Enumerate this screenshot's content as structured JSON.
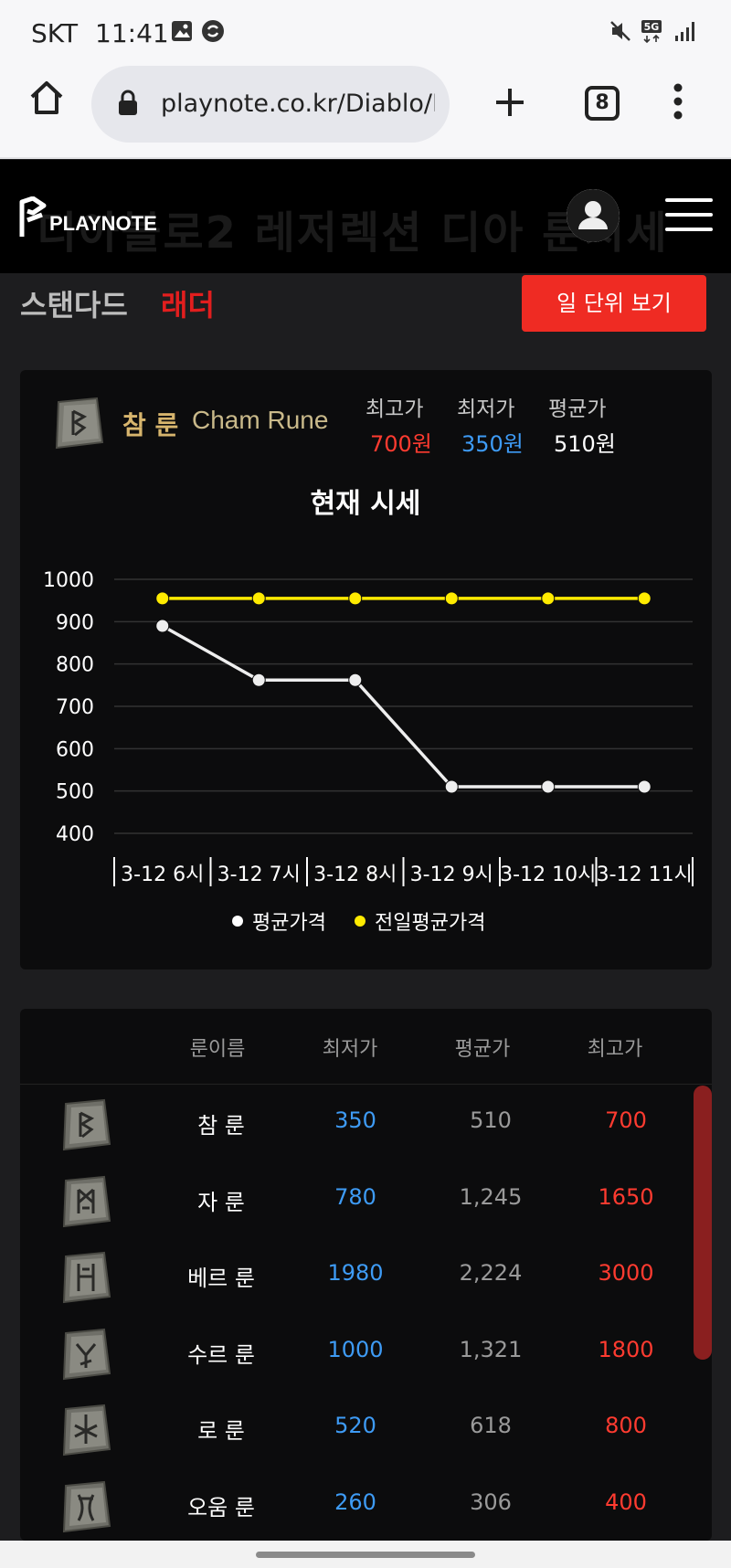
{
  "status_bar": {
    "carrier": "SKT",
    "time": "11:41",
    "network": "5G"
  },
  "browser": {
    "url": "playnote.co.kr/Diablo/Ru",
    "tab_count": "8"
  },
  "site": {
    "logo_text": "PLAYNOTE",
    "ghost_title": "디아블로2 레저렉션 디아 룬시세"
  },
  "mode": {
    "standard": "스탠다드",
    "ladder": "래더",
    "daily_button": "일 단위 보기"
  },
  "rune_card": {
    "name_kr": "참 룬",
    "name_en": "Cham Rune",
    "stats": [
      {
        "label": "최고가",
        "value": "700원",
        "color": "#ff3b30"
      },
      {
        "label": "최저가",
        "value": "350원",
        "color": "#3e9bf5"
      },
      {
        "label": "평균가",
        "value": "510원",
        "color": "#ffffff"
      }
    ],
    "chart_title": "현재 시세"
  },
  "chart_data": {
    "type": "line",
    "categories": [
      "3-12 6시",
      "3-12 7시",
      "3-12 8시",
      "3-12 9시",
      "3-12 10시",
      "3-12 11시"
    ],
    "series": [
      {
        "name": "평균가격",
        "color": "#eeeeee",
        "values": [
          890,
          762,
          762,
          510,
          510,
          510
        ]
      },
      {
        "name": "전일평균가격",
        "color": "#ffeb00",
        "values": [
          955,
          955,
          955,
          955,
          955,
          955
        ]
      }
    ],
    "ylim": [
      400,
      1000
    ],
    "yticks": [
      400,
      500,
      600,
      700,
      800,
      900,
      1000
    ],
    "grid": true,
    "legend_position": "bottom"
  },
  "table": {
    "headers": [
      "룬이름",
      "최저가",
      "평균가",
      "최고가"
    ],
    "colors": {
      "min": "#3e9bf5",
      "avg": "#9a9a9a",
      "max": "#ff3b30",
      "name": "#ffffff"
    },
    "rows": [
      {
        "icon": "cham-rune-icon",
        "name": "참 룬",
        "min": "350",
        "avg": "510",
        "max": "700"
      },
      {
        "icon": "zod-rune-icon",
        "name": "자 룬",
        "min": "780",
        "avg": "1,245",
        "max": "1650"
      },
      {
        "icon": "ber-rune-icon",
        "name": "베르 룬",
        "min": "1980",
        "avg": "2,224",
        "max": "3000"
      },
      {
        "icon": "sur-rune-icon",
        "name": "수르 룬",
        "min": "1000",
        "avg": "1,321",
        "max": "1800"
      },
      {
        "icon": "lo-rune-icon",
        "name": "로 룬",
        "min": "520",
        "avg": "618",
        "max": "800"
      },
      {
        "icon": "ohm-rune-icon",
        "name": "오움 룬",
        "min": "260",
        "avg": "306",
        "max": "400"
      }
    ]
  }
}
